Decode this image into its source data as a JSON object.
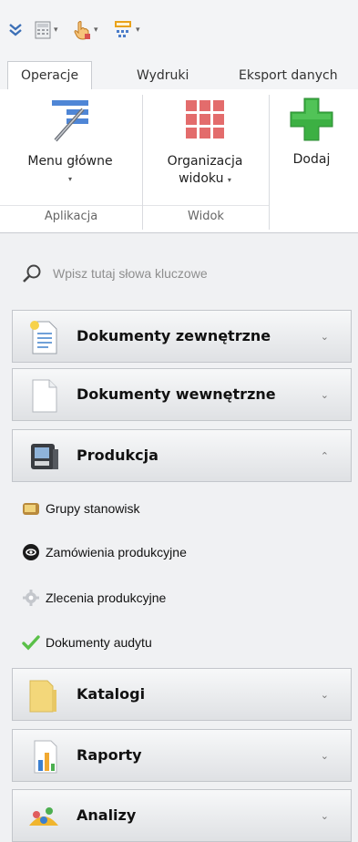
{
  "quick_access": [
    {
      "icon": "double-chevron-down-icon"
    },
    {
      "icon": "calculator-icon"
    },
    {
      "icon": "hand-cursor-icon"
    },
    {
      "icon": "spellcheck-icon"
    }
  ],
  "tabs": [
    {
      "label": "Operacje",
      "active": true
    },
    {
      "label": "Wydruki",
      "active": false
    },
    {
      "label": "Eksport danych",
      "active": false
    }
  ],
  "ribbon": {
    "groups": [
      {
        "label": "Aplikacja",
        "buttons": [
          {
            "label": "Menu główne",
            "icon": "menu-icon",
            "has_dropdown": true
          }
        ]
      },
      {
        "label": "Widok",
        "buttons": [
          {
            "label_line1": "Organizacja",
            "label_line2": "widoku",
            "icon": "grid-icon",
            "has_dropdown": true
          }
        ]
      },
      {
        "label": "",
        "buttons": [
          {
            "label": "Dodaj",
            "icon": "add-icon",
            "has_dropdown": false
          }
        ]
      }
    ]
  },
  "search": {
    "placeholder": "Wpisz tutaj słowa kluczowe"
  },
  "sections": [
    {
      "id": "dokumenty-zewnetrzne",
      "title": "Dokumenty zewnętrzne",
      "expanded": false,
      "icon": "external-document-icon"
    },
    {
      "id": "dokumenty-wewnetrzne",
      "title": "Dokumenty wewnętrzne",
      "expanded": false,
      "icon": "internal-document-icon"
    },
    {
      "id": "produkcja",
      "title": "Produkcja",
      "expanded": true,
      "icon": "production-terminal-icon",
      "items": [
        {
          "label": "Grupy stanowisk",
          "icon": "workstation-group-icon"
        },
        {
          "label": "Zamówienia produkcyjne",
          "icon": "production-order-icon"
        },
        {
          "label": "Zlecenia produkcyjne",
          "icon": "gear-icon"
        },
        {
          "label": "Dokumenty audytu",
          "icon": "checkmark-icon"
        }
      ]
    },
    {
      "id": "katalogi",
      "title": "Katalogi",
      "expanded": false,
      "icon": "folder-icon"
    },
    {
      "id": "raporty",
      "title": "Raporty",
      "expanded": false,
      "icon": "report-chart-icon"
    },
    {
      "id": "analizy",
      "title": "Analizy",
      "expanded": false,
      "icon": "analytics-icon"
    }
  ],
  "chevron_collapsed": "⌄",
  "chevron_expanded": "⌃",
  "dropdown_caret": "▾",
  "colors": {
    "add": "#3cb043",
    "grid": "#e36c6c",
    "folder": "#f3d77a",
    "accent_blue": "#3b6fb6"
  }
}
